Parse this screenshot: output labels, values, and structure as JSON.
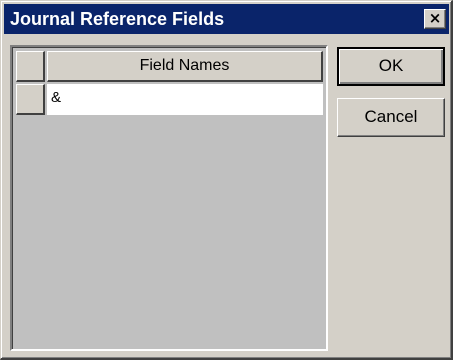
{
  "window": {
    "title": "Journal Reference Fields",
    "close_glyph": "×",
    "titlebar_color": "#0a246a",
    "face_color": "#d4d0c8"
  },
  "grid": {
    "column_header": "Field Names",
    "rows": [
      {
        "value": "&"
      }
    ]
  },
  "buttons": {
    "ok_label": "OK",
    "cancel_label": "Cancel"
  }
}
